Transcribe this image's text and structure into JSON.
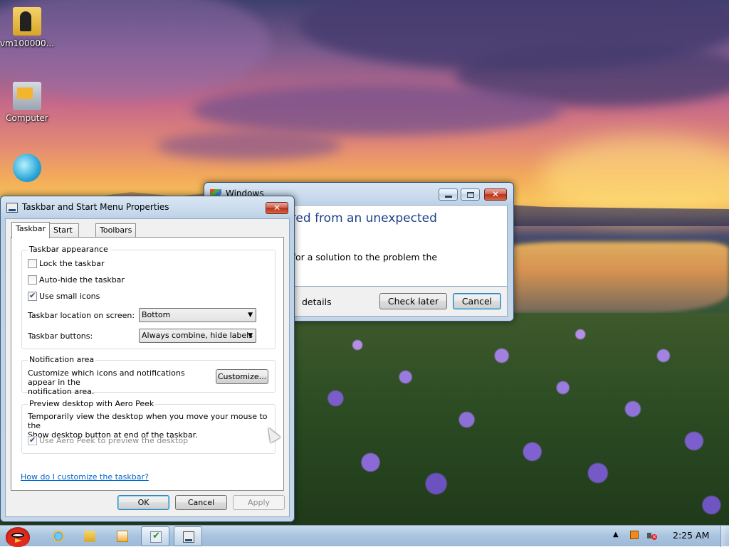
{
  "desktop": {
    "icons": [
      {
        "label": "vm100000...",
        "icon": "user-folder-icon"
      },
      {
        "label": "Computer",
        "icon": "computer-icon"
      },
      {
        "label": "",
        "icon": "network-icon"
      }
    ]
  },
  "error_dialog": {
    "title": "Windows",
    "heading": "has recovered from an unexpected\nn",
    "body": "n check online for a solution to the problem the\nu go online.",
    "details_label": "details",
    "check_later_label": "Check later",
    "cancel_label": "Cancel"
  },
  "props_dialog": {
    "title": "Taskbar and Start Menu Properties",
    "tabs": [
      "Taskbar",
      "Start Menu",
      "Toolbars"
    ],
    "active_tab": "Taskbar",
    "appearance": {
      "group_title": "Taskbar appearance",
      "lock_label": "Lock the taskbar",
      "lock_checked": false,
      "autohide_label": "Auto-hide the taskbar",
      "autohide_checked": false,
      "small_icons_label": "Use small icons",
      "small_icons_checked": true,
      "location_label": "Taskbar location on screen:",
      "location_value": "Bottom",
      "buttons_label": "Taskbar buttons:",
      "buttons_value": "Always combine, hide labels"
    },
    "notification": {
      "group_title": "Notification area",
      "description": "Customize which icons and notifications appear in the\nnotification area.",
      "customize_label": "Customize..."
    },
    "aero_peek": {
      "group_title": "Preview desktop with Aero Peek",
      "description": "Temporarily view the desktop when you move your mouse to the\nShow desktop button at end of the taskbar.",
      "checkbox_label": "Use Aero Peek to preview the desktop",
      "checked": true,
      "disabled": true
    },
    "help_link": "How do I customize the taskbar?",
    "ok_label": "OK",
    "cancel_label": "Cancel",
    "apply_label": "Apply"
  },
  "taskbar": {
    "start_icon": "angry-bird-icon",
    "pinned": [
      "internet-explorer-icon",
      "windows-explorer-icon",
      "media-player-icon",
      "checkmark-app-icon",
      "taskbar-properties-icon"
    ],
    "clock": "2:25 AM",
    "tray_icons": [
      "show-hidden-icons-arrow",
      "action-center-icon",
      "volume-muted-icon"
    ]
  },
  "colors": {
    "heading_blue": "#1e3f8a",
    "link_blue": "#0066cc",
    "close_red": "#c8432c"
  }
}
